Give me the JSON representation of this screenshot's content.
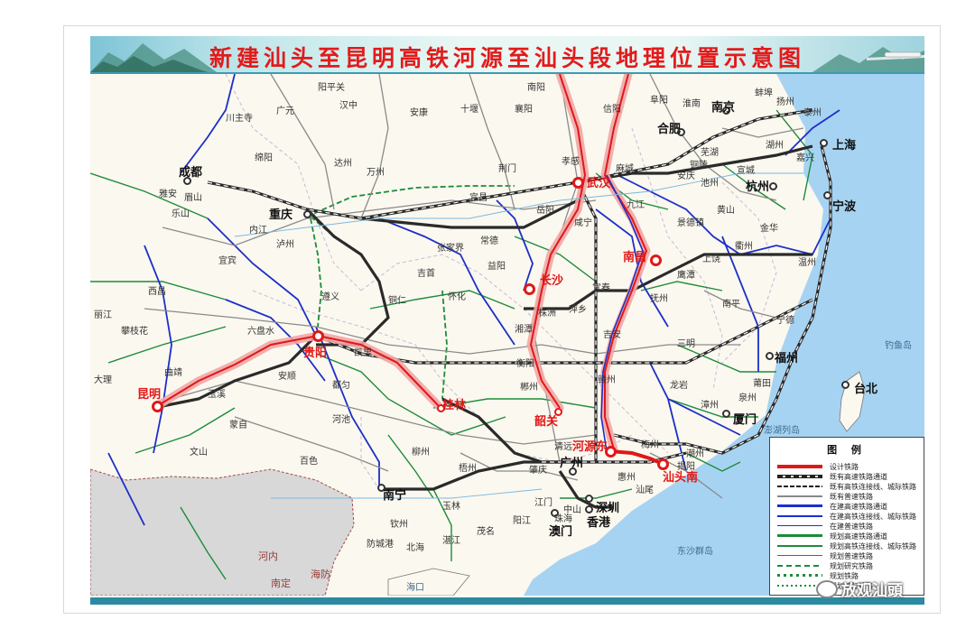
{
  "title": "新建汕头至昆明高铁河源至汕头段地理位置示意图",
  "watermark": "放观汕頭",
  "colors": {
    "design_line": "#e01818",
    "highlight": "#f1a6a6",
    "built_hsr": "#2a2a2a",
    "built_rail": "#8a8a8a",
    "construction": "#1c2fc9",
    "planned": "#1c8c3a",
    "sea": "#a7d3f2",
    "land": "#fbf8ef",
    "foreign_land": "#d8d8d8"
  },
  "legend": {
    "title": "图 例",
    "items": [
      {
        "label": "设计铁路",
        "style": "design"
      },
      {
        "label": "既有高速铁路通道",
        "style": "built_hsr"
      },
      {
        "label": "既有高铁连接线、城际铁路",
        "style": "built_link"
      },
      {
        "label": "既有普速铁路",
        "style": "built_rail"
      },
      {
        "label": "在建高速铁路通道",
        "style": "con_hsr"
      },
      {
        "label": "在建高铁连接线、城际铁路",
        "style": "con_link"
      },
      {
        "label": "在建普速铁路",
        "style": "con_rail"
      },
      {
        "label": "规划高速铁路通道",
        "style": "plan_hsr"
      },
      {
        "label": "规划高铁连接线、城际铁路",
        "style": "plan_link"
      },
      {
        "label": "规划普速铁路",
        "style": "plan_rail"
      },
      {
        "label": "规划研究铁路",
        "style": "study"
      },
      {
        "label": "规划铁路",
        "style": "plan_dots"
      },
      {
        "label": "规划城际铁路",
        "style": "plan_intercity"
      }
    ]
  },
  "cities_major": [
    {
      "name": "成都"
    },
    {
      "name": "重庆"
    },
    {
      "name": "贵阳"
    },
    {
      "name": "昆明"
    },
    {
      "name": "武汉"
    },
    {
      "name": "长沙"
    },
    {
      "name": "南昌"
    },
    {
      "name": "南京"
    },
    {
      "name": "合肥"
    },
    {
      "name": "上海"
    },
    {
      "name": "杭州"
    },
    {
      "name": "宁波"
    },
    {
      "name": "福州"
    },
    {
      "name": "厦门"
    },
    {
      "name": "台北"
    },
    {
      "name": "广州"
    },
    {
      "name": "深圳"
    },
    {
      "name": "香港"
    },
    {
      "name": "澳门"
    },
    {
      "name": "南宁"
    },
    {
      "name": "桂林"
    },
    {
      "name": "韶关"
    },
    {
      "name": "河源东"
    },
    {
      "name": "汕头南"
    }
  ],
  "cities_minor": [
    "川主寺",
    "广元",
    "阳平关",
    "汉中",
    "安康",
    "十堰",
    "襄阳",
    "南阳",
    "信阳",
    "阜阳",
    "淮南",
    "蚌埠",
    "泰州",
    "扬州",
    "绵阳",
    "达州",
    "万州",
    "宜昌",
    "荆门",
    "孝感",
    "麻城",
    "安庆",
    "池州",
    "铜陵",
    "芜湖",
    "宣城",
    "湖州",
    "嘉兴",
    "雅安",
    "眉山",
    "乐山",
    "内江",
    "宜宾",
    "泸州",
    "遵义",
    "铜仁",
    "怀化",
    "吉首",
    "张家界",
    "常德",
    "益阳",
    "岳阳",
    "咸宁",
    "九江",
    "景德镇",
    "黄山",
    "衢州",
    "金华",
    "温州",
    "西昌",
    "攀枝花",
    "丽江",
    "大理",
    "六盘水",
    "安顺",
    "凯里",
    "都匀",
    "株洲",
    "湘潭",
    "衡阳",
    "郴州",
    "萍乡",
    "宜春",
    "吉安",
    "赣州",
    "抚州",
    "鹰潭",
    "上饶",
    "南平",
    "三明",
    "龙岩",
    "宁德",
    "莆田",
    "泉州",
    "漳州",
    "曲靖",
    "玉溪",
    "蒙自",
    "文山",
    "百色",
    "河池",
    "柳州",
    "梧州",
    "玉林",
    "北海",
    "防城港",
    "钦州",
    "湛江",
    "茂名",
    "阳江",
    "江门",
    "中山",
    "珠海",
    "肇庆",
    "清远",
    "惠州",
    "汕尾",
    "梅州",
    "潮州",
    "揭阳"
  ],
  "foreign_labels": [
    "河内",
    "南定",
    "海防"
  ],
  "sea_labels": [
    "东沙群岛",
    "钓鱼岛",
    "澎湖列岛",
    "海口"
  ]
}
